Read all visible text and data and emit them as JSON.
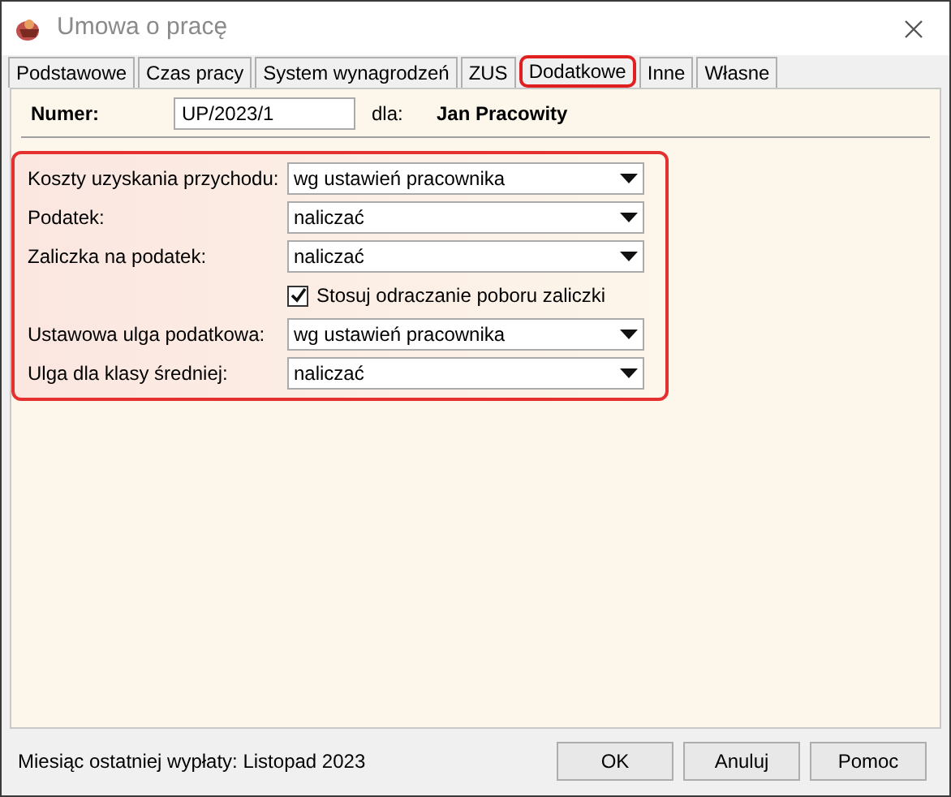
{
  "window": {
    "title": "Umowa o pracę"
  },
  "tabs": [
    {
      "label": "Podstawowe",
      "selected": false
    },
    {
      "label": "Czas pracy",
      "selected": false
    },
    {
      "label": "System wynagrodzeń",
      "selected": false
    },
    {
      "label": "ZUS",
      "selected": false
    },
    {
      "label": "Dodatkowe",
      "selected": true
    },
    {
      "label": "Inne",
      "selected": false
    },
    {
      "label": "Własne",
      "selected": false
    }
  ],
  "header": {
    "number_label": "Numer:",
    "number_value": "UP/2023/1",
    "for_label": "dla:",
    "employee": "Jan Pracowity"
  },
  "fields": [
    {
      "kind": "combo",
      "label": "Koszty uzyskania przychodu:",
      "value": "wg ustawień pracownika"
    },
    {
      "kind": "combo",
      "label": "Podatek:",
      "value": "naliczać"
    },
    {
      "kind": "combo",
      "label": "Zaliczka na podatek:",
      "value": "naliczać"
    },
    {
      "kind": "checkbox",
      "label": "Stosuj odraczanie poboru zaliczki",
      "checked": true
    },
    {
      "kind": "combo",
      "label": "Ustawowa ulga podatkowa:",
      "value": "wg ustawień pracownika"
    },
    {
      "kind": "combo",
      "label": "Ulga dla klasy średniej:",
      "value": "naliczać"
    }
  ],
  "status": "Miesiąc ostatniej wypłaty: Listopad 2023",
  "buttons": [
    "OK",
    "Anuluj",
    "Pomoc"
  ]
}
